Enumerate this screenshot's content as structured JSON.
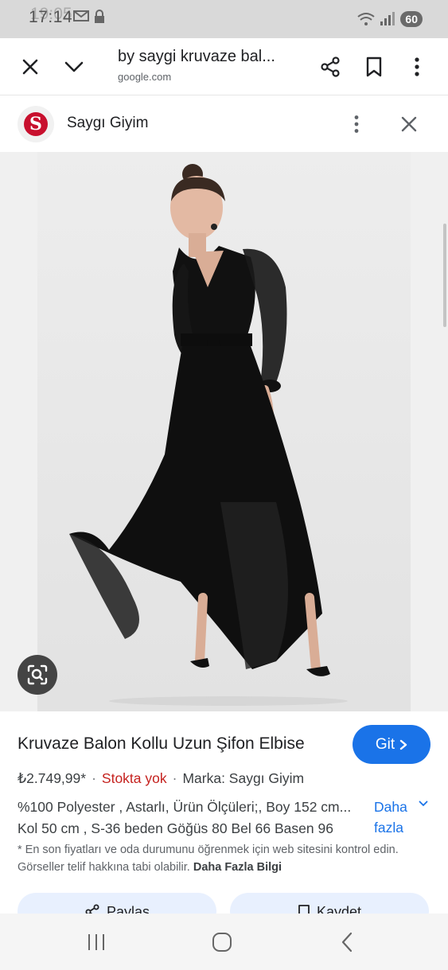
{
  "status_bar": {
    "time": "17:14",
    "time_overlay": "19:05",
    "battery": "60"
  },
  "browser": {
    "tab_title": "by saygi kruvaze bal...",
    "domain": "google.com"
  },
  "source": {
    "logo_letter": "S",
    "name": "Saygı Giyim"
  },
  "product": {
    "title": "Kruvaze Balon Kollu Uzun Şifon Elbise",
    "visit_label": "Git",
    "price": "₺2.749,99*",
    "stock": "Stokta yok",
    "brand": "Marka: Saygı Giyim",
    "description_lines": [
      "%100 Polyester , Astarlı, Ürün Ölçüleri;, Boy 152 cm...",
      "Kol 50 cm , S-36 beden Göğüs 80 Bel 66 Basen 96"
    ],
    "more_label_1": "Daha",
    "more_label_2": "fazla",
    "disclaimer": "* En son fiyatları ve oda durumunu öğrenmek için web sitesini kontrol edin. Görseller telif hakkına tabi olabilir.",
    "disclaimer_link": "Daha Fazla Bilgi",
    "share_label": "Paylaş",
    "save_label": "Kaydet"
  },
  "colors": {
    "accent": "#1a73e8",
    "out_of_stock": "#c5221f",
    "brand_red": "#c8102e"
  }
}
